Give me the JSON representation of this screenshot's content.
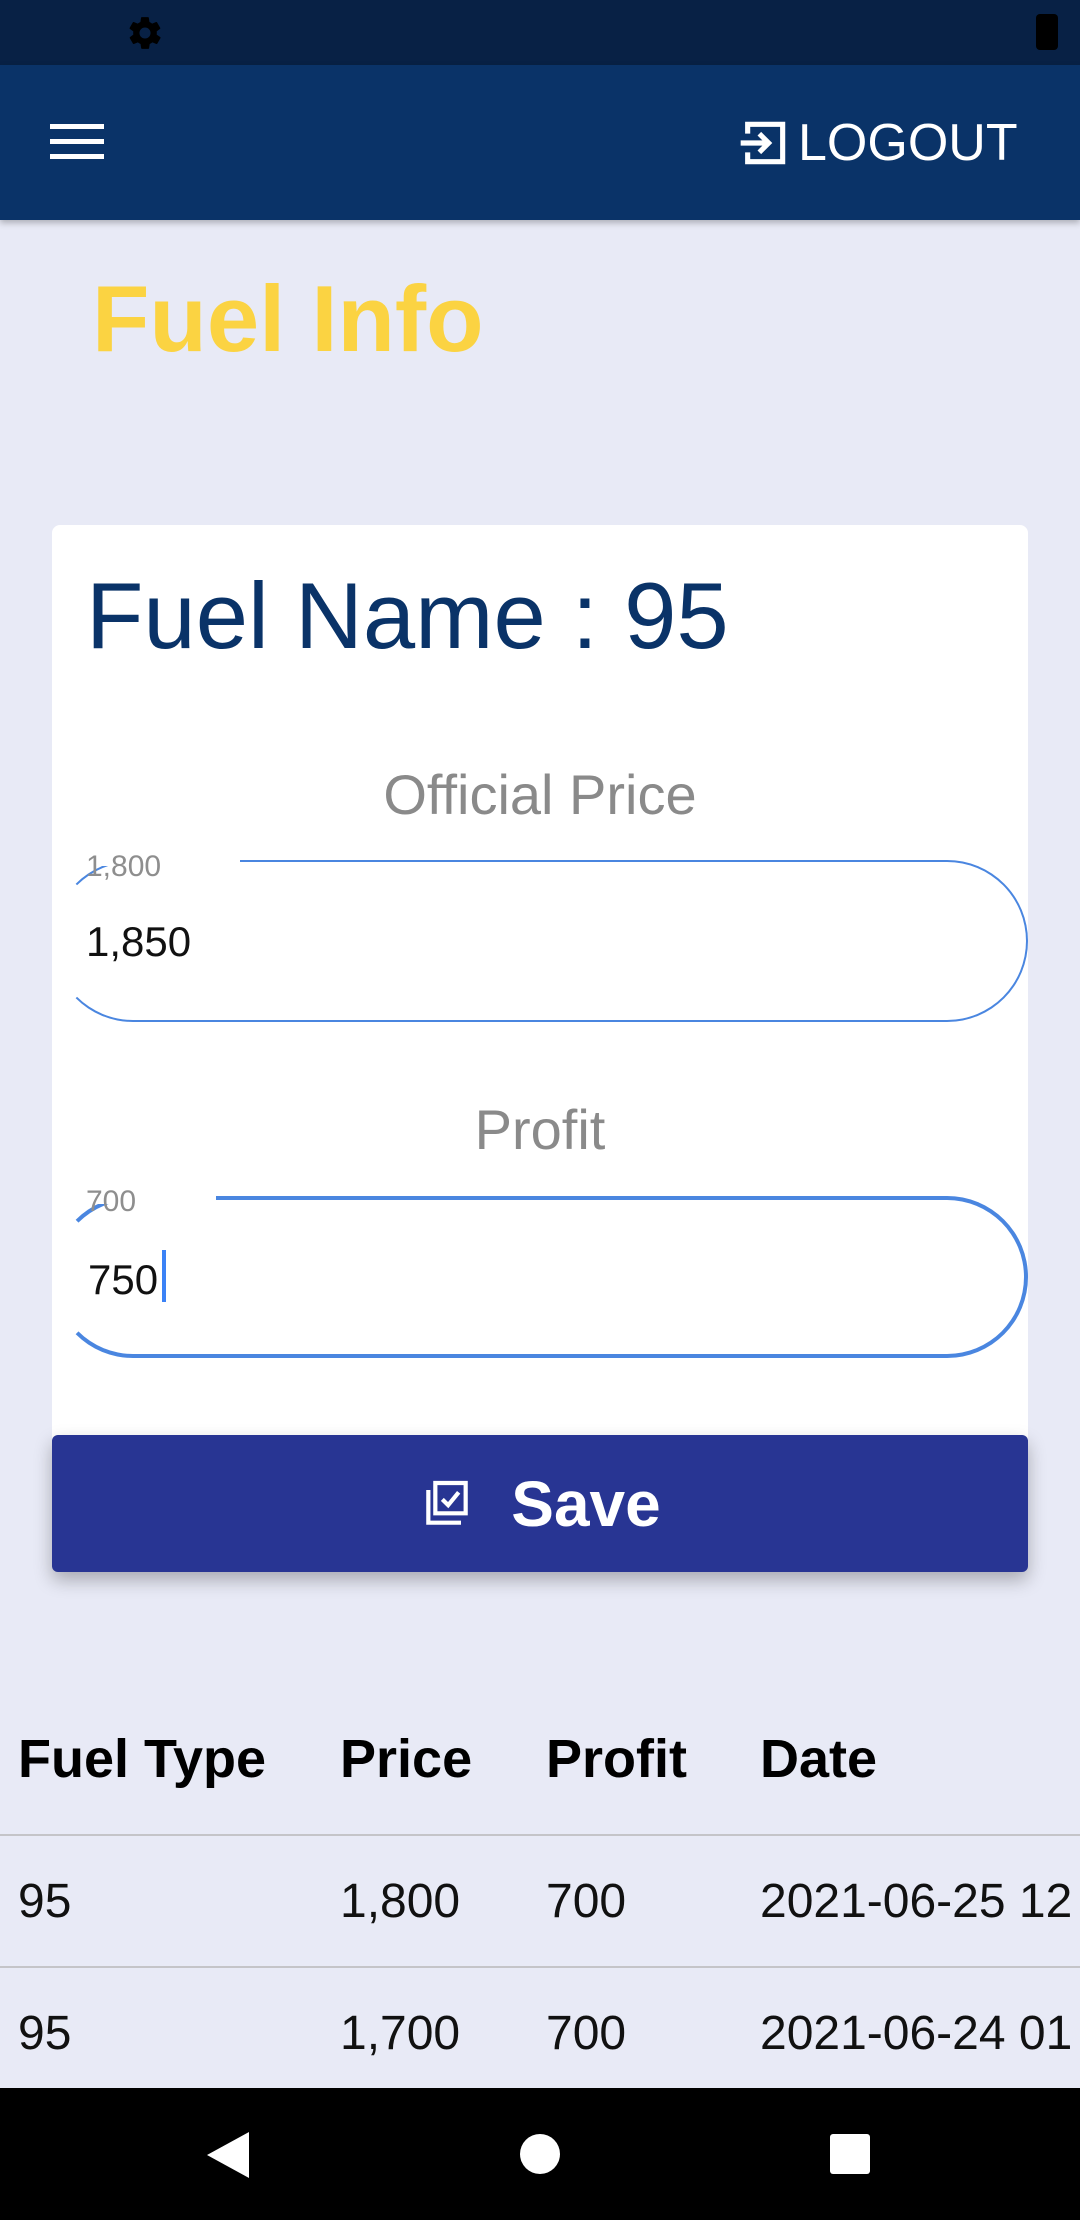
{
  "status_bar": {
    "icons": [
      "gear-icon",
      "battery-icon"
    ]
  },
  "app_bar": {
    "menu_icon": "hamburger-menu-icon",
    "logout_label": "LOGOUT",
    "logout_icon": "login-arrow-icon",
    "background": "#0A3368"
  },
  "page": {
    "title": "Fuel Info",
    "title_color": "#FBD342"
  },
  "card": {
    "fuel_name": "Fuel Name : 95",
    "official_price": {
      "label": "Official Price",
      "hint": "1,800",
      "value": "1,850"
    },
    "profit": {
      "label": "Profit",
      "hint": "700",
      "value": "750"
    },
    "save_label": "Save",
    "save_color": "#283593"
  },
  "table": {
    "headers": [
      "Fuel Type",
      "Price",
      "Profit",
      "Date"
    ],
    "rows": [
      [
        "95",
        "1,800",
        "700",
        "2021-06-25 12"
      ],
      [
        "95",
        "1,700",
        "700",
        "2021-06-24 01"
      ]
    ]
  },
  "nav_bar": {
    "icons": [
      "back-icon",
      "home-icon",
      "recents-icon"
    ]
  }
}
